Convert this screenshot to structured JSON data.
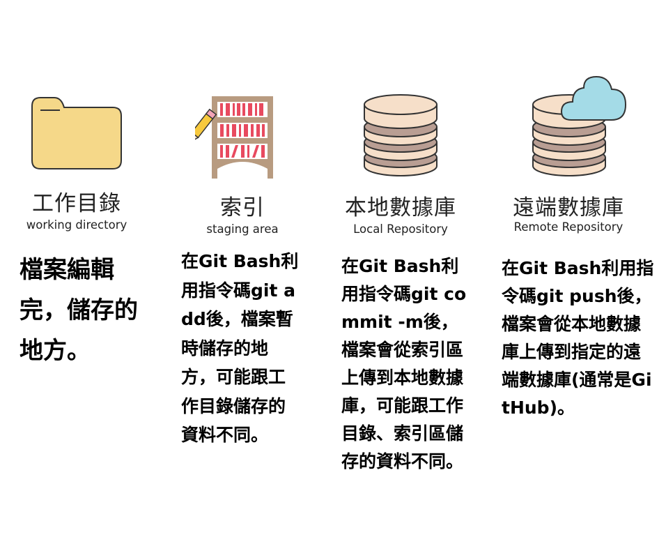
{
  "columns": [
    {
      "icon": "folder-icon",
      "title": "工作目錄",
      "subtitle": "working directory",
      "description": "檔案編輯完，儲存的地方。"
    },
    {
      "icon": "bookshelf-pencil-icon",
      "title": "索引",
      "subtitle": "staging area",
      "description": "在Git Bash利用指令碼git add後，檔案暫時儲存的地方，可能跟工作目錄儲存的資料不同。"
    },
    {
      "icon": "database-icon",
      "title": "本地數據庫",
      "subtitle": "Local Repository",
      "description": "在Git Bash利用指令碼git commit -m後，檔案會從索引區上傳到本地數據庫，可能跟工作目錄、索引區儲存的資料不同。"
    },
    {
      "icon": "cloud-database-icon",
      "title": "遠端數據庫",
      "subtitle": "Remote Repository",
      "description": "在Git Bash利用指令碼git push後，檔案會從本地數據庫上傳到指定的遠端數據庫(通常是GitHub)。"
    }
  ],
  "colors": {
    "folder": "#f5d889",
    "outline": "#333333",
    "shelf": "#b89b80",
    "book": "#e84a5f",
    "disk_light": "#f6dfc9",
    "disk_dark": "#b99e93",
    "cloud": "#a4dbe7",
    "pencil": "#f7c93e"
  }
}
